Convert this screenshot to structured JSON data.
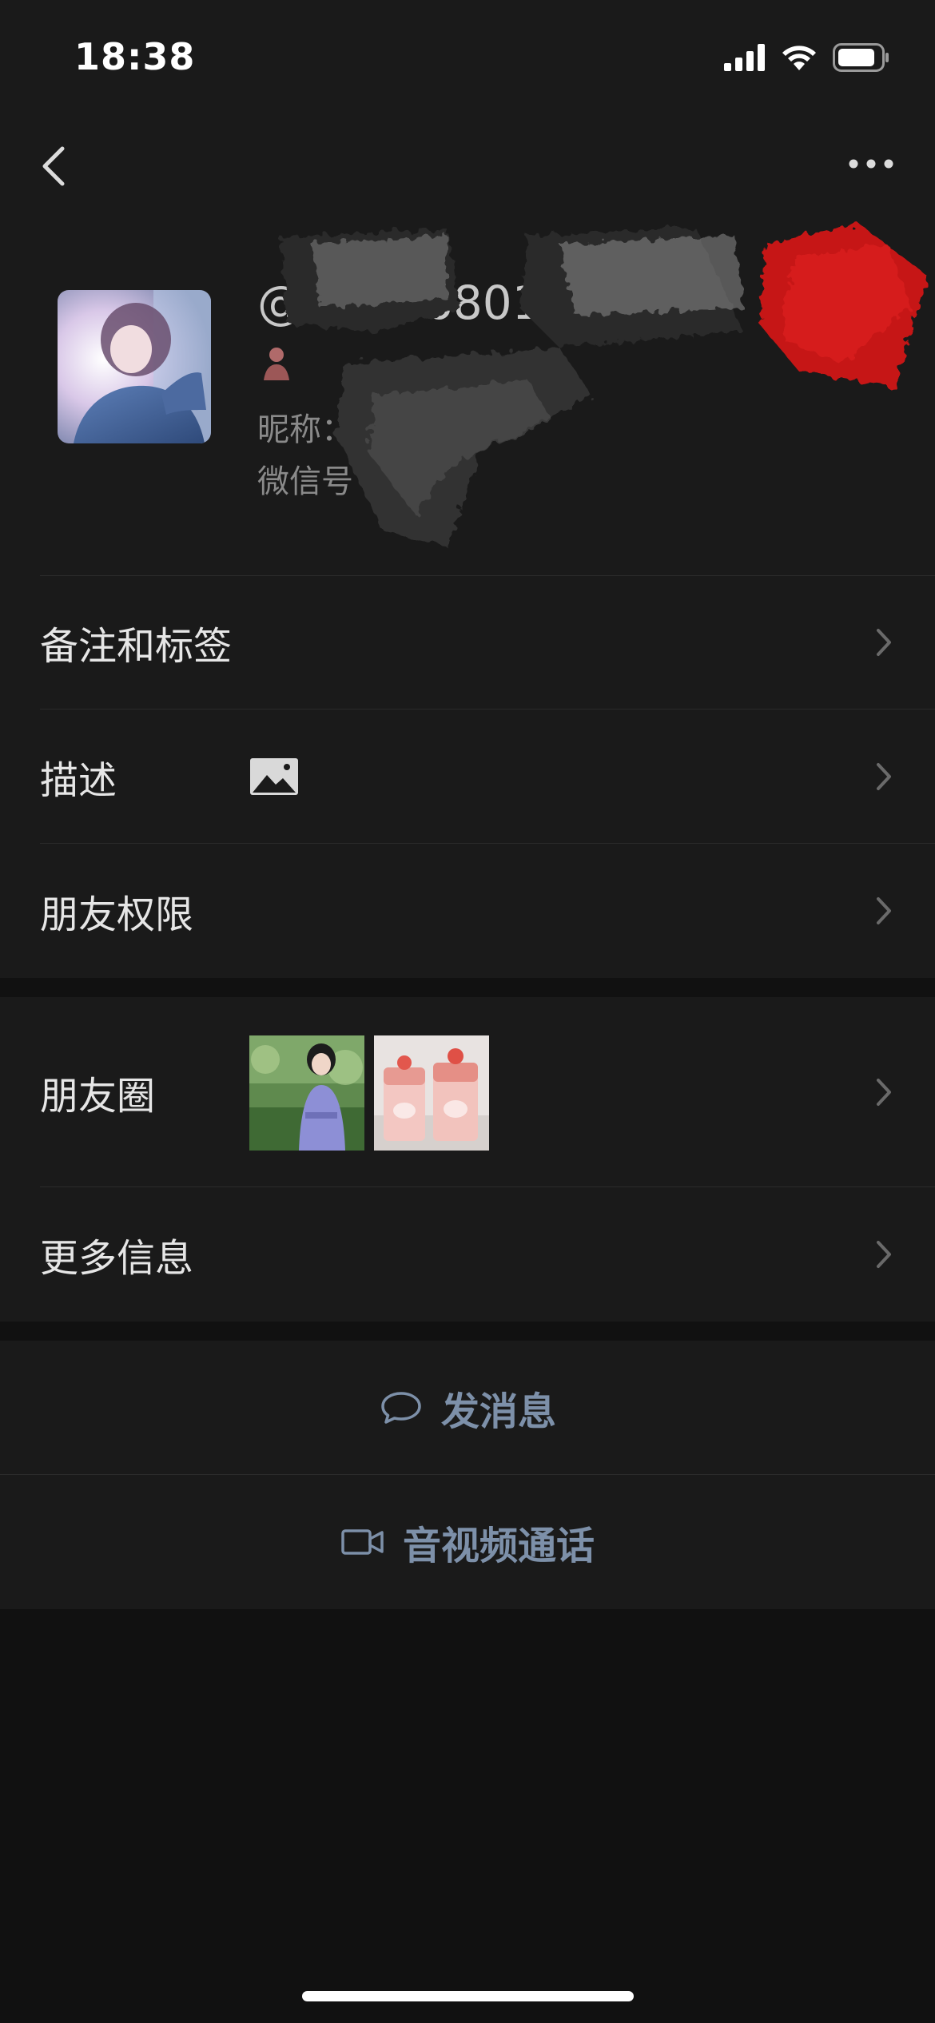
{
  "status_bar": {
    "time": "18:38",
    "icons": [
      "signal-icon",
      "wifi-icon",
      "battery-icon"
    ]
  },
  "nav_bar": {
    "back_icon": "chevron-left-icon",
    "more_icon": "more-dots-icon"
  },
  "profile": {
    "name_visible": "@",
    "name_partial_digits": "6801",
    "nickname_label": "昵称：",
    "wechat_id_label": "微信号",
    "gender_icon": "gender-icon"
  },
  "list_group_1": [
    {
      "label": "备注和标签"
    },
    {
      "label": "描述",
      "icon": "image-icon"
    },
    {
      "label": "朋友权限"
    }
  ],
  "list_group_2": [
    {
      "label": "朋友圈",
      "thumbnails": 2
    },
    {
      "label": "更多信息"
    }
  ],
  "actions": [
    {
      "label": "发消息",
      "icon": "chat-bubble-icon"
    },
    {
      "label": "音视频通话",
      "icon": "video-camera-icon"
    }
  ],
  "colors": {
    "background": "#111111",
    "panel": "#1a1a1a",
    "divider": "#2b2b2b",
    "text_primary": "#e6e6e6",
    "text_secondary": "#8a8a8a",
    "action_text": "#7d90a9"
  }
}
